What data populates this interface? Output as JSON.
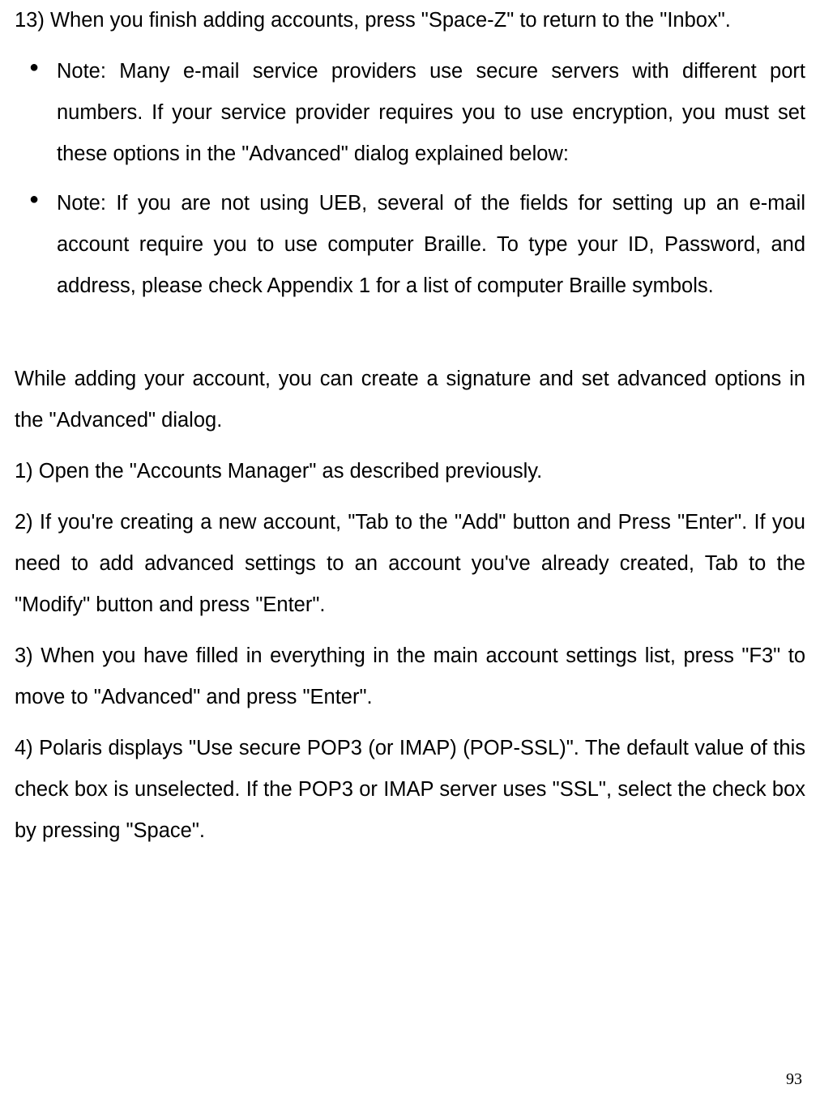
{
  "p13": "13) When you finish adding accounts, press \"Space-Z\" to return to the \"Inbox\".",
  "bullets": [
    "Note: Many e-mail service providers use secure servers with different port numbers. If your service provider requires you to use encryption, you must set these options in the \"Advanced\" dialog explained below:",
    "Note: If you are not using UEB, several of the fields for setting up an e-mail account require you to use computer Braille. To type your ID, Password, and address, please check Appendix 1 for a list of computer Braille symbols."
  ],
  "intro": "While adding your account, you can create a signature and set advanced options in the \"Advanced\" dialog.",
  "step1": "1) Open the \"Accounts Manager\" as described previously.",
  "step2": "2) If you're creating a new account, \"Tab to the \"Add\" button and Press \"Enter\". If you need to add advanced settings to an account you've already created, Tab to the \"Modify\" button and press \"Enter\".",
  "step3": "3) When you have filled in everything in the main account settings list, press \"F3\" to move to \"Advanced\" and press \"Enter\".",
  "step4": "4) Polaris displays \"Use secure POP3 (or IMAP) (POP-SSL)\". The default value of this check box is unselected. If the POP3 or IMAP server uses \"SSL\", select the check box by pressing \"Space\".",
  "pageNumber": "93"
}
